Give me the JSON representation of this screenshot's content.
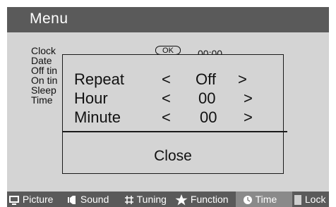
{
  "menu": {
    "title": "Menu",
    "background_labels": [
      "Clock",
      "Date",
      "Off tin",
      "On tin",
      "Sleep",
      "Time"
    ],
    "ok_label": "OK",
    "clock_value": "00:00"
  },
  "dialog": {
    "rows": [
      {
        "label": "Repeat",
        "left": "<",
        "value": "Off",
        "right": ">"
      },
      {
        "label": "Hour",
        "left": "<",
        "value": "00",
        "right": ">"
      },
      {
        "label": "Minute",
        "left": "<",
        "value": "00",
        "right": ">"
      }
    ],
    "close_label": "Close"
  },
  "bottom_tabs": [
    {
      "label": "Picture",
      "icon": "picture-icon"
    },
    {
      "label": "Sound",
      "icon": "sound-icon"
    },
    {
      "label": "Tuning",
      "icon": "tuning-icon"
    },
    {
      "label": "Function",
      "icon": "star-icon"
    },
    {
      "label": "Time",
      "icon": "clock-icon",
      "active": true
    },
    {
      "label": "Lock",
      "icon": "lock-icon"
    }
  ],
  "colors": {
    "header_bg": "#5a5a5a",
    "panel_bg": "#d4d4d4",
    "active_tab_bg": "#8a8a8a"
  }
}
